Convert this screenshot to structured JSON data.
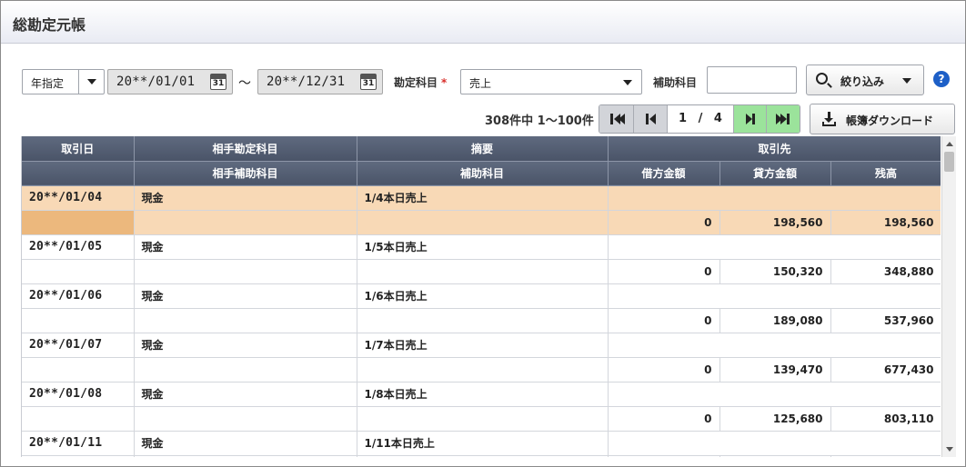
{
  "app": {
    "title": "総勘定元帳"
  },
  "filters": {
    "period_type": "年指定",
    "date_from": "20**/01/01",
    "date_to": "20**/12/31",
    "tilde": "～",
    "calendar_day": "31",
    "account_label": "勘定科目",
    "required_mark": "*",
    "account_value": "売上",
    "sub_account_label": "補助科目",
    "sub_account_value": "",
    "filter_button": "絞り込み",
    "help_glyph": "?"
  },
  "pager": {
    "summary": "308件中 1～100件",
    "current_page": "1",
    "separator": "/",
    "total_pages": "4"
  },
  "download_button": "帳簿ダウンロード",
  "table": {
    "header_row1": [
      "取引日",
      "相手勘定科目",
      "摘要",
      "取引先"
    ],
    "header_row2": [
      "",
      "相手補助科目",
      "補助科目",
      "借方金額",
      "貸方金額",
      "残高"
    ],
    "entries": [
      {
        "date": "20**/01/04",
        "account": "現金",
        "memo": "1/4本日売上",
        "sub_account": "",
        "sub_memo": "",
        "debit": "0",
        "credit": "198,560",
        "balance": "198,560"
      },
      {
        "date": "20**/01/05",
        "account": "現金",
        "memo": "1/5本日売上",
        "sub_account": "",
        "sub_memo": "",
        "debit": "0",
        "credit": "150,320",
        "balance": "348,880"
      },
      {
        "date": "20**/01/06",
        "account": "現金",
        "memo": "1/6本日売上",
        "sub_account": "",
        "sub_memo": "",
        "debit": "0",
        "credit": "189,080",
        "balance": "537,960"
      },
      {
        "date": "20**/01/07",
        "account": "現金",
        "memo": "1/7本日売上",
        "sub_account": "",
        "sub_memo": "",
        "debit": "0",
        "credit": "139,470",
        "balance": "677,430"
      },
      {
        "date": "20**/01/08",
        "account": "現金",
        "memo": "1/8本日売上",
        "sub_account": "",
        "sub_memo": "",
        "debit": "0",
        "credit": "125,680",
        "balance": "803,110"
      },
      {
        "date": "20**/01/11",
        "account": "現金",
        "memo": "1/11本日売上",
        "sub_account": "",
        "sub_memo": "",
        "debit": "",
        "credit": "",
        "balance": ""
      }
    ]
  },
  "colors": {
    "header_bg": "#4f596d",
    "selected_row": "#f8d9b6",
    "selected_cell": "#ecb87d",
    "pager_active": "#9be39b",
    "pager_disabled": "#d2d4d9",
    "required": "#d9302c",
    "help": "#1d5fc7"
  },
  "icons": [
    "chevron-down-icon",
    "calendar-icon",
    "search-icon",
    "first-page-icon",
    "prev-page-icon",
    "next-page-icon",
    "last-page-icon",
    "download-icon",
    "help-icon"
  ]
}
